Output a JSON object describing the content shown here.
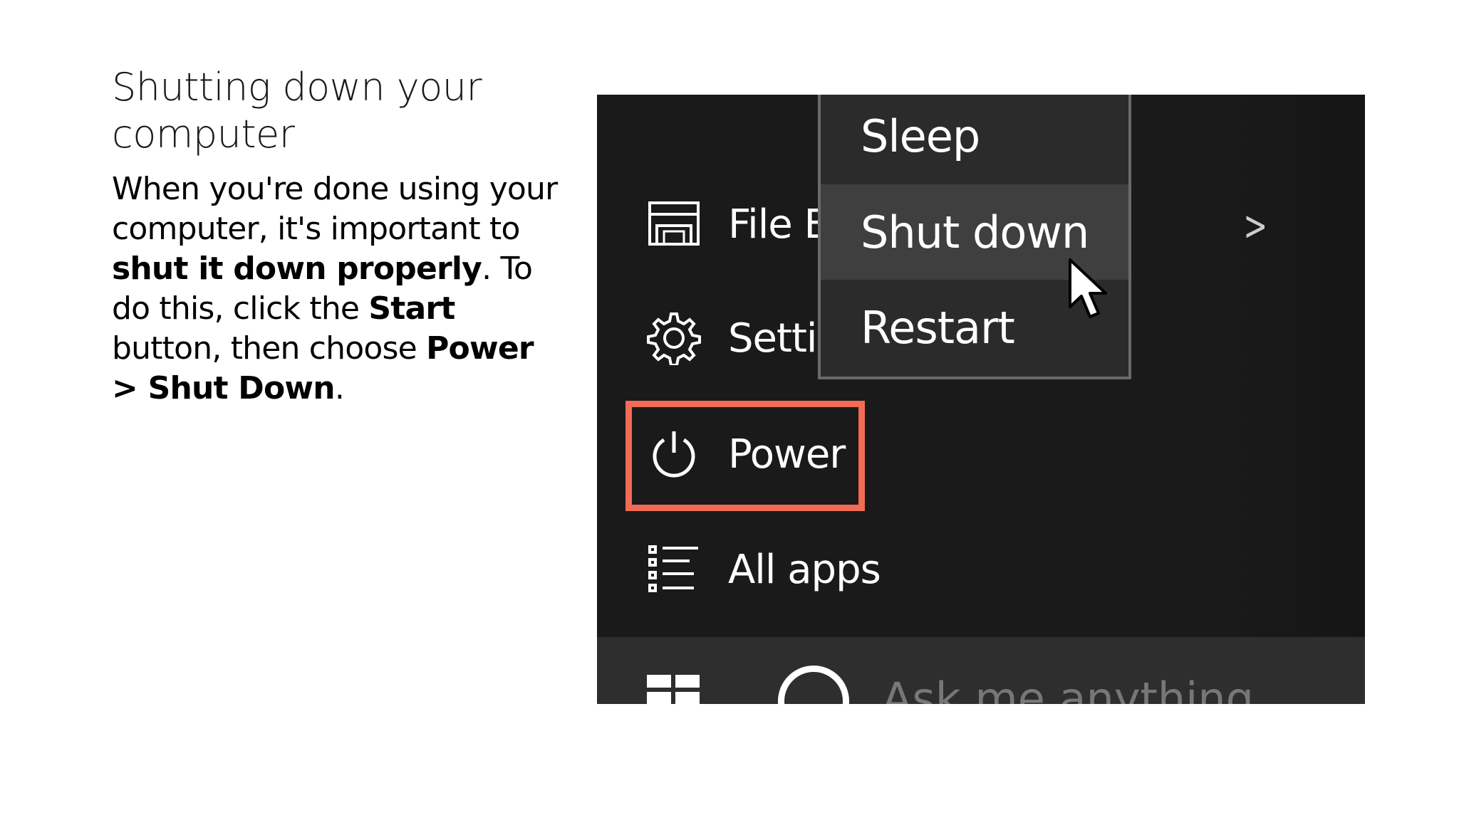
{
  "slide": {
    "title": "Shutting down your computer",
    "body": {
      "intro": "When you're done using your computer, it's important to ",
      "emphasis1": "shut it down properly",
      "mid": ". To do this, click the ",
      "emphasis2": "Start",
      "mid2": " button, then choose ",
      "emphasis3": "Power > Shut Down",
      "end": "."
    }
  },
  "start_menu": {
    "items": [
      {
        "label": "File Ex",
        "icon": "file-explorer-icon"
      },
      {
        "label": "Settin",
        "icon": "gear-icon"
      },
      {
        "label": "Power",
        "icon": "power-icon"
      },
      {
        "label": "All apps",
        "icon": "list-icon"
      }
    ],
    "chevron": ">",
    "highlight_color": "#f26b55"
  },
  "power_flyout": {
    "items": [
      {
        "label": "Sleep"
      },
      {
        "label": "Shut down"
      },
      {
        "label": "Restart"
      }
    ]
  },
  "taskbar": {
    "search_placeholder": "Ask me anything"
  }
}
